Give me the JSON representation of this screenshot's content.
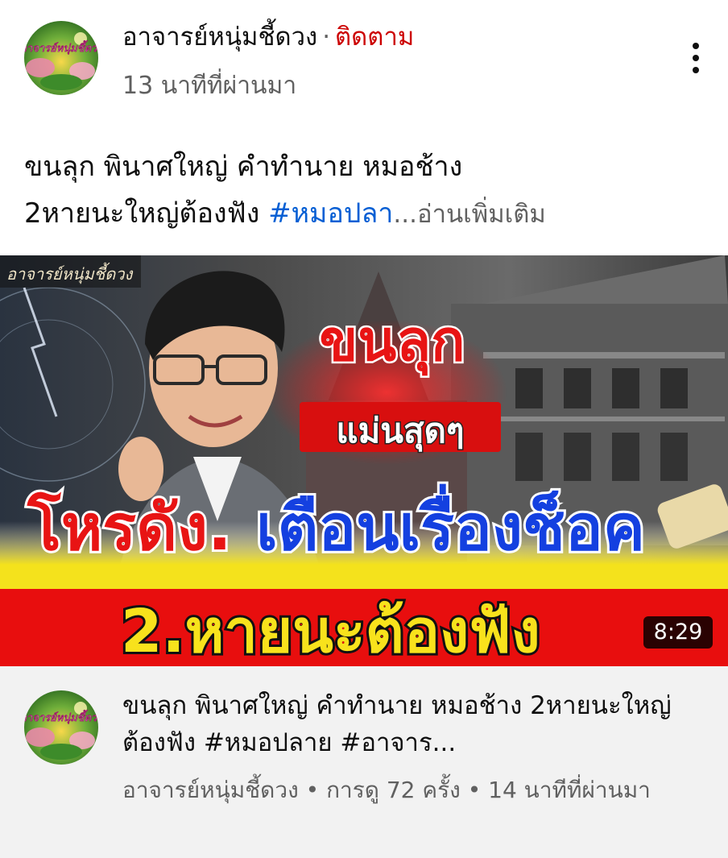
{
  "post": {
    "channel_name": "อาจารย์หนุ่มชี้ดวง",
    "separator": "·",
    "follow_label": "ติดตาม",
    "time_ago": "13 นาทีที่ผ่านมา",
    "more_icon": "more-vertical-icon",
    "text_line1": "ขนลุก พินาศใหญ่ คำทำนาย หมอช้าง",
    "text_line2": "2หายนะใหญ่ต้องฟัง ",
    "hashtag": "#หมอปลา",
    "read_more": "...อ่านเพิ่มเติม"
  },
  "thumbnail": {
    "corner_label": "อาจารย์หนุ่มชี้ดวง",
    "headline1": "ขนลุก",
    "headline2": "แม่นสุดๆ",
    "headline3_red": "โหรดัง.",
    "headline3_blue": "เตือนเรื่องช็อค",
    "headline4": "2.หายนะต้องฟัง",
    "duration": "8:29",
    "avatar_text": "อาจารย์หนุ่มชี้ดวง"
  },
  "video": {
    "title": "ขนลุก พินาศใหญ่ คำทำนาย หมอช้าง 2หายนะใหญ่ต้องฟัง #หมอปลาย #อาจาร...",
    "meta": "อาจารย์หนุ่มชี้ดวง • การดู 72 ครั้ง • 14 นาทีที่ผ่านมา"
  },
  "colors": {
    "follow": "#cc0000",
    "hashtag": "#065fd4",
    "secondary_text": "#606060",
    "card_background": "#f2f2f2"
  }
}
